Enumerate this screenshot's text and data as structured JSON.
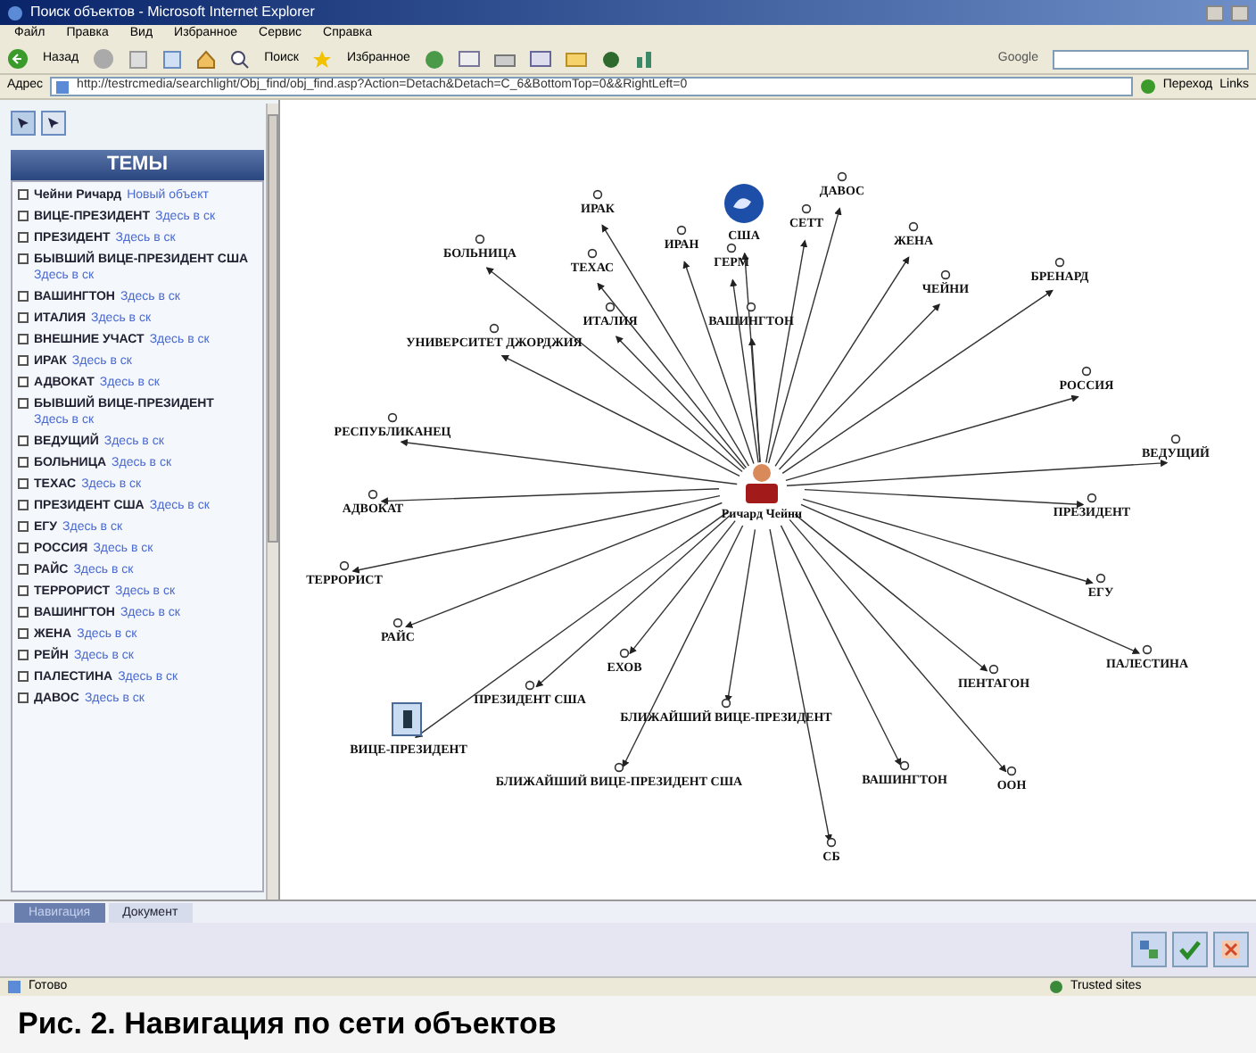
{
  "window": {
    "title": "Поиск объектов - Microsoft Internet Explorer"
  },
  "menu": [
    "Файл",
    "Правка",
    "Вид",
    "Избранное",
    "Сервис",
    "Справка"
  ],
  "toolbar": {
    "back": "Назад",
    "search": "Поиск",
    "favorites": "Избранное",
    "google": "Google"
  },
  "address": {
    "label": "Адрес",
    "url": "http://testrcmedia/searchlight/Obj_find/obj_find.asp?Action=Detach&Detach=C_6&BottomTop=0&&RightLeft=0",
    "go": "Переход",
    "links": "Links"
  },
  "sidebar": {
    "title": "ТЕМЫ",
    "items": [
      {
        "label": "Чейни Ричард",
        "link": "Новый объект",
        "checked": false
      },
      {
        "label": "ВИЦЕ-ПРЕЗИДЕНТ",
        "link": "Здесь в ск",
        "checked": false
      },
      {
        "label": "ПРЕЗИДЕНТ",
        "link": "Здесь в ск",
        "checked": false
      },
      {
        "label": "БЫВШИЙ ВИЦЕ-ПРЕЗИДЕНТ США",
        "link": "Здесь в ск",
        "checked": false
      },
      {
        "label": "ВАШИНГТОН",
        "link": "Здесь в ск",
        "checked": false
      },
      {
        "label": "ИТАЛИЯ",
        "link": "Здесь в ск",
        "checked": false
      },
      {
        "label": "ВНЕШНИЕ УЧАСТ",
        "link": "Здесь в ск",
        "checked": false
      },
      {
        "label": "ИРАК",
        "link": "Здесь в ск",
        "checked": false
      },
      {
        "label": "АДВОКАТ",
        "link": "Здесь в ск",
        "checked": false
      },
      {
        "label": "БЫВШИЙ ВИЦЕ-ПРЕЗИДЕНТ",
        "link": "Здесь в ск",
        "checked": false
      },
      {
        "label": "ВЕДУЩИЙ",
        "link": "Здесь в ск",
        "checked": false
      },
      {
        "label": "БОЛЬНИЦА",
        "link": "Здесь в ск",
        "checked": false
      },
      {
        "label": "ТЕХАС",
        "link": "Здесь в ск",
        "checked": false
      },
      {
        "label": "ПРЕЗИДЕНТ США",
        "link": "Здесь в ск",
        "checked": false
      },
      {
        "label": "ЕГУ",
        "link": "Здесь в ск",
        "checked": false
      },
      {
        "label": "РОССИЯ",
        "link": "Здесь в ск",
        "checked": false
      },
      {
        "label": "РАЙС",
        "link": "Здесь в ск",
        "checked": false
      },
      {
        "label": "ТЕРРОРИСТ",
        "link": "Здесь в ск",
        "checked": false
      },
      {
        "label": "ВАШИНГТОН",
        "link": "Здесь в ск",
        "checked": false
      },
      {
        "label": "ЖЕНА",
        "link": "Здесь в ск",
        "checked": false
      },
      {
        "label": "РЕЙН",
        "link": "Здесь в ск",
        "checked": false
      },
      {
        "label": "ПАЛЕСТИНА",
        "link": "Здесь в ск",
        "checked": false
      },
      {
        "label": "ДАВОС",
        "link": "Здесь в ск",
        "checked": false
      }
    ]
  },
  "graph": {
    "center": {
      "label": "Ричард Чейни",
      "kind": "person"
    },
    "nodes": [
      {
        "label": "ИРАК",
        "kind": "dot"
      },
      {
        "label": "США",
        "kind": "globe"
      },
      {
        "label": "ДАВОС",
        "kind": "dot"
      },
      {
        "label": "ИРАН",
        "kind": "dot"
      },
      {
        "label": "СЕТТ",
        "kind": "dot"
      },
      {
        "label": "ГЕРМ",
        "kind": "dot"
      },
      {
        "label": "ЖЕНА",
        "kind": "dot"
      },
      {
        "label": "БОЛЬНИЦА",
        "kind": "dot"
      },
      {
        "label": "ТЕХАС",
        "kind": "dot"
      },
      {
        "label": "ЧЕЙНИ",
        "kind": "dot"
      },
      {
        "label": "БРЕНАРД",
        "kind": "dot"
      },
      {
        "label": "ИТАЛИЯ",
        "kind": "dot"
      },
      {
        "label": "ВАШИНГТОН",
        "kind": "dot"
      },
      {
        "label": "УНИВЕРСИТЕТ ДЖОРДЖИЯ",
        "kind": "dot"
      },
      {
        "label": "РОССИЯ",
        "kind": "dot"
      },
      {
        "label": "РЕСПУБЛИКАНЕЦ",
        "kind": "dot"
      },
      {
        "label": "ВЕДУЩИЙ",
        "kind": "dot"
      },
      {
        "label": "АДВОКАТ",
        "kind": "dot"
      },
      {
        "label": "ПРЕЗИДЕНТ",
        "kind": "dot"
      },
      {
        "label": "ТЕРРОРИСТ",
        "kind": "dot"
      },
      {
        "label": "ЕГУ",
        "kind": "dot"
      },
      {
        "label": "РАЙС",
        "kind": "dot"
      },
      {
        "label": "ПАЛЕСТИНА",
        "kind": "dot"
      },
      {
        "label": "ЕХОВ",
        "kind": "dot"
      },
      {
        "label": "ПЕНТАГОН",
        "kind": "dot"
      },
      {
        "label": "ПРЕЗИДЕНТ США",
        "kind": "dot"
      },
      {
        "label": "БЛИЖАЙШИЙ ВИЦЕ-ПРЕЗИДЕНТ",
        "kind": "dot"
      },
      {
        "label": "ВИЦЕ-ПРЕЗИДЕНТ",
        "kind": "document"
      },
      {
        "label": "БЛИЖАЙШИЙ ВИЦЕ-ПРЕЗИДЕНТ США",
        "kind": "dot"
      },
      {
        "label": "ВАШИНГТОН",
        "kind": "dot"
      },
      {
        "label": "ООН",
        "kind": "dot"
      },
      {
        "label": "СБ",
        "kind": "dot"
      }
    ]
  },
  "tabs": [
    {
      "label": "Навигация",
      "selected": true
    },
    {
      "label": "Документ",
      "selected": false
    }
  ],
  "status_bar": {
    "text": "Готово",
    "zone": "Trusted sites"
  },
  "caption": "Рис. 2. Навигация по сети объектов"
}
